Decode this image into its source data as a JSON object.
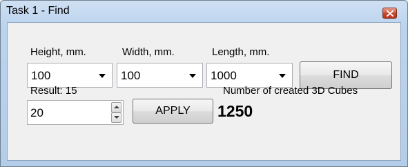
{
  "window": {
    "title": "Task 1 - Find"
  },
  "fields": {
    "height": {
      "label": "Height, mm.",
      "value": "100"
    },
    "width": {
      "label": "Width, mm.",
      "value": "100"
    },
    "length": {
      "label": "Length, mm.",
      "value": "1000"
    }
  },
  "buttons": {
    "find": "FIND",
    "apply": "APPLY"
  },
  "result": {
    "label": "Result: 15",
    "spinner_value": "20"
  },
  "cubes": {
    "label": "Number of created 3D Cubes",
    "count": "1250"
  },
  "icons": {
    "close": "close-icon",
    "dropdown": "chevron-down-icon",
    "spin_up": "arrow-up-icon",
    "spin_down": "arrow-down-icon"
  },
  "colors": {
    "close_button": "#c9462c",
    "titlebar": "#bad3ee",
    "client_bg": "#f0f0f0"
  }
}
